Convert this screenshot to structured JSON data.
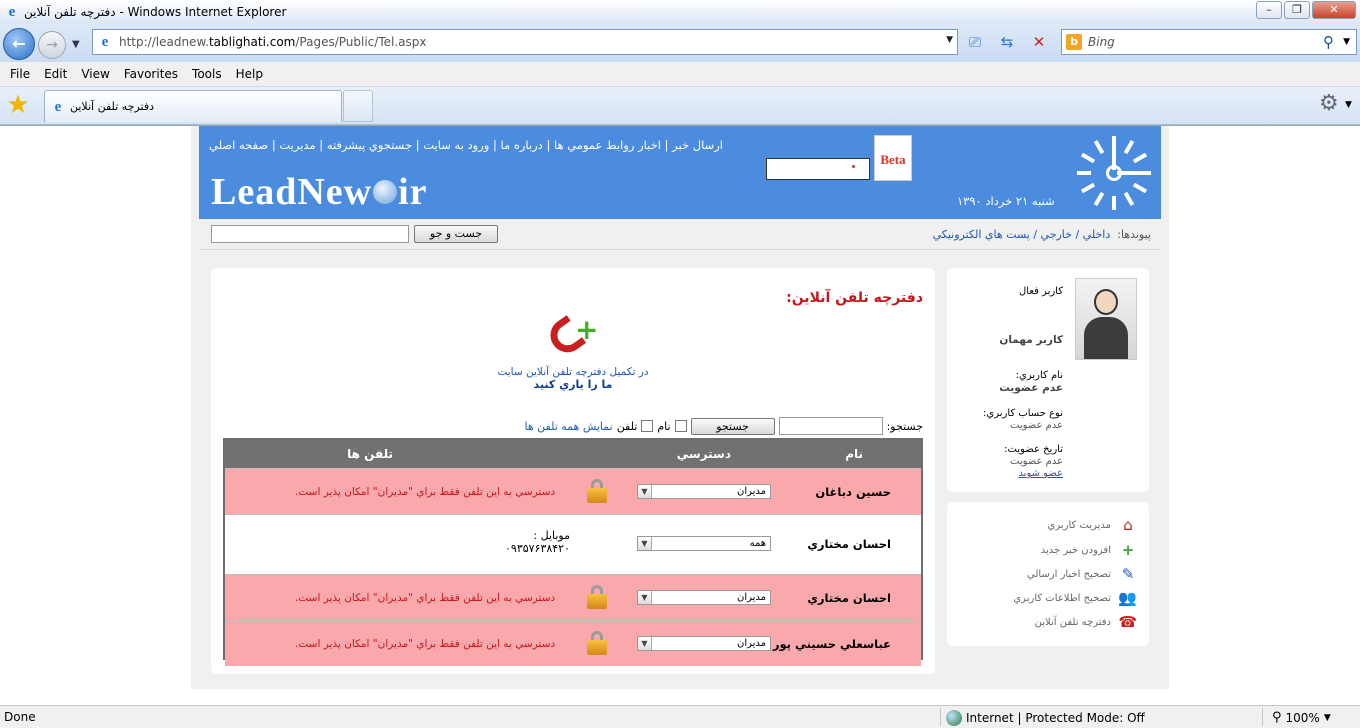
{
  "window": {
    "title": "دفترچه تلفن آنلاين - Windows Internet Explorer",
    "min_icon": "minimize-icon",
    "max_icon": "maximize-icon",
    "close_icon": "close-icon"
  },
  "address_bar": {
    "url_prefix": "http://leadnew.",
    "url_domain": "tablighati.com",
    "url_suffix": "/Pages/Public/Tel.aspx"
  },
  "search_bar": {
    "placeholder": "Bing"
  },
  "menu": [
    "File",
    "Edit",
    "View",
    "Favorites",
    "Tools",
    "Help"
  ],
  "tab": {
    "title": "دفترچه تلفن آنلاين"
  },
  "header": {
    "nav": "ارسال خبر | اخبار روابط عمومي ها | درباره ما | ورود به سايت | جستجوي پيشرفته | مديريت | صفحه اصلي",
    "logo_left": "LeadNew",
    "logo_right": "ir",
    "beta": "Beta",
    "date": "شنبه ۲۱ خرداد ۱۳۹۰"
  },
  "link_bar": {
    "search_button": "جست و جو",
    "label": "پيوندها:",
    "links": "داخلي / خارجي / پست هاي الكترونيكي"
  },
  "main": {
    "title": "دفترچه تلفن آنلاين:",
    "help_line1": "در تكميل دفترچه تلفن آنلاين سايت",
    "help_line2": "ما را ياري كنيد",
    "search_label": "جستجو:",
    "search_button": "جستجو",
    "name_label": "نام",
    "phone_label": "تلفن",
    "show_all": "نمايش همه تلفن ها"
  },
  "table": {
    "headers": {
      "name": "نام",
      "access": "دسترسي",
      "phones": "تلفن ها"
    },
    "rows": [
      {
        "name": "حسين دباغان",
        "access": "مديران",
        "locked": true,
        "message": "دسترسي به اين تلفن فقط براي \"مديران\" امكان پذير است."
      },
      {
        "name": "احسان مختاري",
        "access": "همه",
        "locked": false,
        "mobile_label": "موبايل :",
        "mobile": "۰۹۳۵۷۶۳۸۴۲۰"
      },
      {
        "name": "احسان مختاري",
        "access": "مديران",
        "locked": true,
        "message": "دسترسي به اين تلفن فقط براي \"مديران\" امكان پذير است."
      },
      {
        "name": "عباسعلي حسيني پور",
        "access": "مديران",
        "locked": true,
        "message": "دسترسي به اين تلفن فقط براي \"مديران\" امكان پذير است."
      }
    ]
  },
  "sidebar": {
    "active_user": "كاربر فعال",
    "guest": "كاربر مهمان",
    "username_label": "نام كاربري:",
    "username_value": "عدم عضويت",
    "account_type_label": "نوع حساب كاربري:",
    "account_type_value": "عدم عضويت",
    "join_date_label": "تاريخ عضويت:",
    "join_date_value": "عدم عضويت",
    "join_link": "عضو شويد",
    "menu": [
      {
        "label": "مديريت كاربري",
        "icon": "house-icon"
      },
      {
        "label": "افزودن خبر جديد",
        "icon": "add-news-icon"
      },
      {
        "label": "تصحيح اخبار ارسالي",
        "icon": "edit-news-icon"
      },
      {
        "label": "تصحيح اطلاعات كاربري",
        "icon": "users-icon"
      },
      {
        "label": "دفترچه تلفن آنلاين",
        "icon": "phone-icon"
      }
    ]
  },
  "status_bar": {
    "status": "Done",
    "zone": "Internet | Protected Mode: Off",
    "zoom": "100%"
  }
}
